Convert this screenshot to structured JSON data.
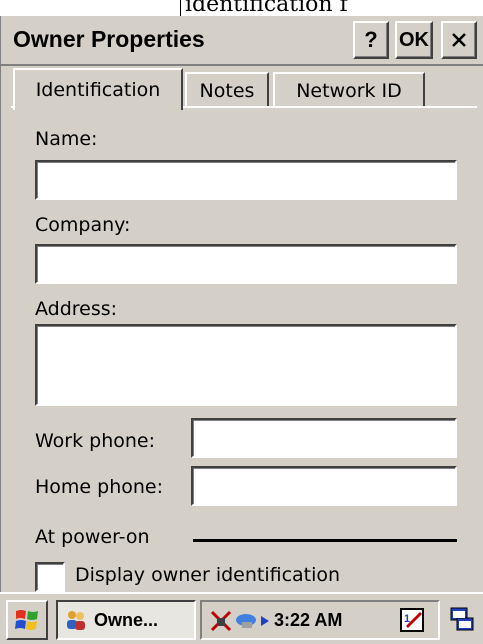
{
  "window": {
    "title": "Owner Properties",
    "help_label": "?",
    "ok_label": "OK",
    "close_icon": "close-icon"
  },
  "tabs": [
    {
      "label": "Identification",
      "active": true
    },
    {
      "label": "Notes",
      "active": false
    },
    {
      "label": "Network ID",
      "active": false
    }
  ],
  "form": {
    "name_label": "Name:",
    "name_value": "",
    "company_label": "Company:",
    "company_value": "",
    "address_label": "Address:",
    "address_value": "",
    "work_phone_label": "Work phone:",
    "work_phone_value": "",
    "home_phone_label": "Home phone:",
    "home_phone_value": "",
    "power_on_label": "At power-on",
    "display_owner_label": "Display owner identification",
    "display_owner_checked": false
  },
  "taskbar": {
    "task_label": "Owne...",
    "clock": "3:22 AM",
    "icons": [
      "start-windows-icon",
      "owner-people-icon",
      "network-disconnected-icon",
      "connection-icon",
      "arrow-right-icon",
      "input-panel-icon",
      "desktop-windows-icon"
    ]
  },
  "background": {
    "partial_text": "identification f"
  },
  "colors": {
    "face": "#d4d0c8",
    "highlight": "#ffffff",
    "shadow": "#404040"
  }
}
